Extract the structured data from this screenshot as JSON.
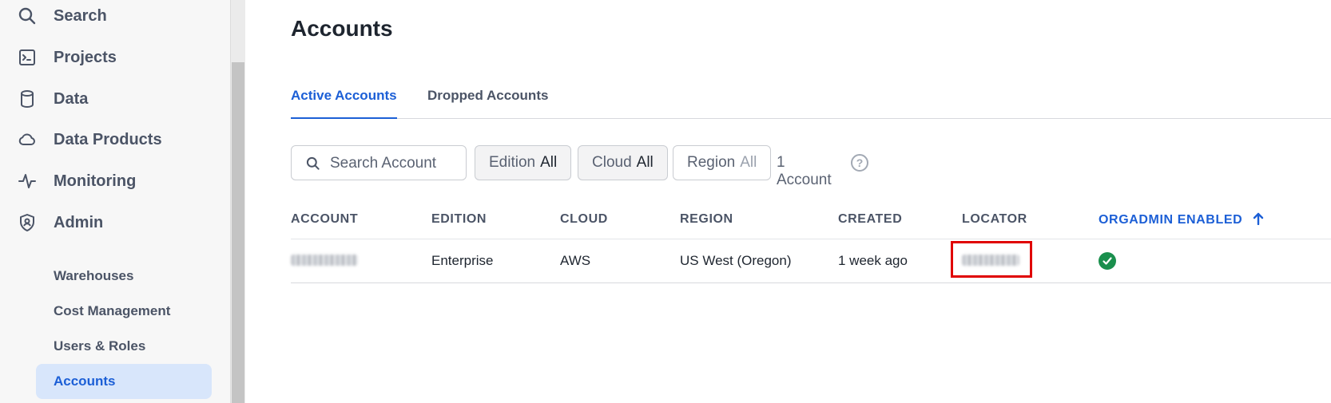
{
  "sidebar": {
    "items": [
      {
        "label": "Search",
        "icon": "search-icon"
      },
      {
        "label": "Projects",
        "icon": "terminal-icon"
      },
      {
        "label": "Data",
        "icon": "database-icon"
      },
      {
        "label": "Data Products",
        "icon": "cloud-icon"
      },
      {
        "label": "Monitoring",
        "icon": "activity-icon"
      },
      {
        "label": "Admin",
        "icon": "shield-user-icon"
      }
    ],
    "sub_items": [
      {
        "label": "Warehouses"
      },
      {
        "label": "Cost Management"
      },
      {
        "label": "Users & Roles"
      },
      {
        "label": "Accounts",
        "active": true
      }
    ]
  },
  "main": {
    "title": "Accounts",
    "tabs": [
      {
        "label": "Active Accounts",
        "active": true
      },
      {
        "label": "Dropped Accounts",
        "active": false
      }
    ],
    "search": {
      "placeholder": "Search Account",
      "value": ""
    },
    "filters": [
      {
        "name": "Edition",
        "value": "All"
      },
      {
        "name": "Cloud",
        "value": "All"
      },
      {
        "name": "Region",
        "value": "All"
      }
    ],
    "count_text": "1 Account",
    "help_icon": "?",
    "table": {
      "columns": [
        "ACCOUNT",
        "EDITION",
        "CLOUD",
        "REGION",
        "CREATED",
        "LOCATOR",
        "ORGADMIN ENABLED"
      ],
      "sort_column": "ORGADMIN ENABLED",
      "sort_direction": "ascending",
      "rows": [
        {
          "account": "[redacted]",
          "edition": "Enterprise",
          "cloud": "AWS",
          "region": "US West (Oregon)",
          "created": "1 week ago",
          "locator": "[redacted]",
          "orgadmin_enabled": true
        }
      ]
    }
  },
  "colors": {
    "accent": "#1c5fd6",
    "active_nav_bg": "#d8e6fb",
    "success": "#1a8f4d",
    "highlight": "#e00000"
  }
}
